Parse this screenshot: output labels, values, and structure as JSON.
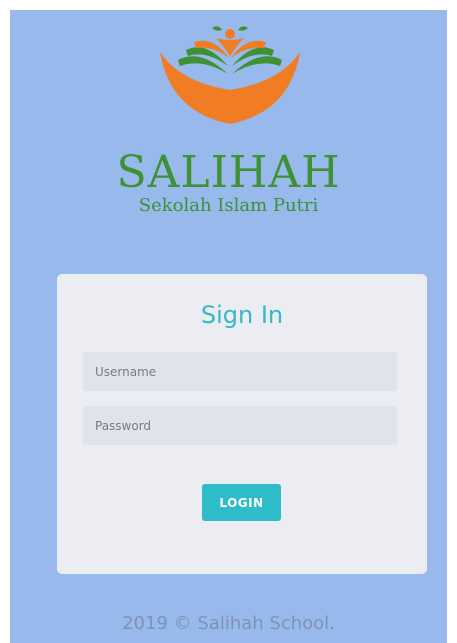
{
  "brand": {
    "name": "SALIHAH",
    "tagline": "Sekolah Islam Putri",
    "colors": {
      "green": "#3f9134",
      "orange": "#f07d24"
    }
  },
  "login_card": {
    "title": "Sign In",
    "username_placeholder": "Username",
    "password_placeholder": "Password",
    "login_label": "LOGIN"
  },
  "footer": {
    "text": "2019 © Salihah School."
  },
  "theme": {
    "background": "#98b9ec",
    "accent": "#2fbcc9"
  }
}
